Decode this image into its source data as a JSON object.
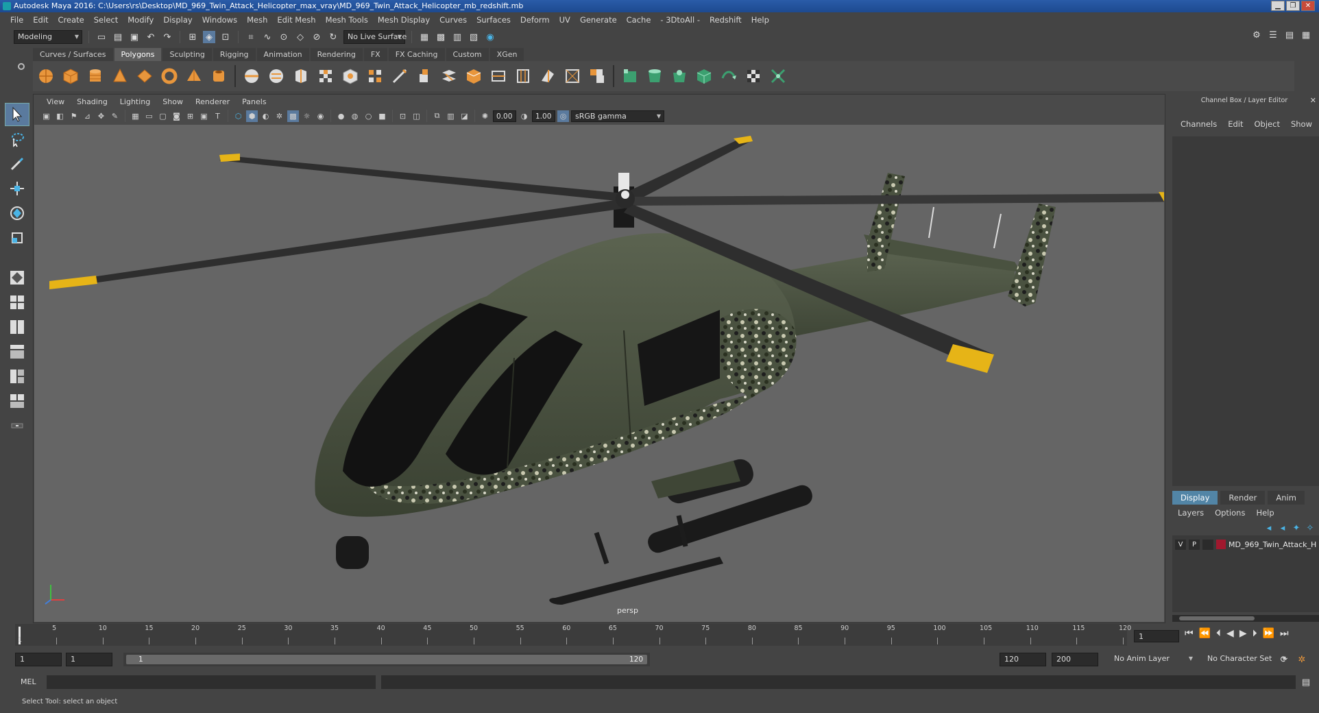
{
  "window": {
    "title": "Autodesk Maya 2016: C:\\Users\\rs\\Desktop\\MD_969_Twin_Attack_Helicopter_max_vray\\MD_969_Twin_Attack_Helicopter_mb_redshift.mb"
  },
  "menubar": {
    "items": [
      "File",
      "Edit",
      "Create",
      "Select",
      "Modify",
      "Display",
      "Windows",
      "Mesh",
      "Edit Mesh",
      "Mesh Tools",
      "Mesh Display",
      "Curves",
      "Surfaces",
      "Deform",
      "UV",
      "Generate",
      "Cache",
      "- 3DtoAll -",
      "Redshift",
      "Help"
    ]
  },
  "statusline": {
    "mode": "Modeling",
    "live_surface": "No Live Surface"
  },
  "shelf": {
    "tabs": [
      "Curves / Surfaces",
      "Polygons",
      "Sculpting",
      "Rigging",
      "Animation",
      "Rendering",
      "FX",
      "FX Caching",
      "Custom",
      "XGen"
    ],
    "active_tab": "Polygons"
  },
  "viewport": {
    "menu": [
      "View",
      "Shading",
      "Lighting",
      "Show",
      "Renderer",
      "Panels"
    ],
    "exposure": "0.00",
    "gamma": "1.00",
    "color_space": "sRGB gamma",
    "camera_label": "persp"
  },
  "channel_box": {
    "title": "Channel Box / Layer Editor",
    "menu": [
      "Channels",
      "Edit",
      "Object",
      "Show"
    ]
  },
  "layer_editor": {
    "tabs": [
      "Display",
      "Render",
      "Anim"
    ],
    "active_tab": "Display",
    "menu": [
      "Layers",
      "Options",
      "Help"
    ],
    "layer": {
      "visible": "V",
      "playback": "P",
      "name": "MD_969_Twin_Attack_H",
      "color": "#a0182e"
    }
  },
  "time_slider": {
    "ticks": [
      "5",
      "10",
      "15",
      "20",
      "25",
      "30",
      "35",
      "40",
      "45",
      "50",
      "55",
      "60",
      "65",
      "70",
      "75",
      "80",
      "85",
      "90",
      "95",
      "100",
      "105",
      "110",
      "115",
      "120"
    ],
    "start_tick": "1",
    "current_frame": "1"
  },
  "range_slider": {
    "start": "1",
    "playback_start": "1",
    "range_start_label": "1",
    "range_end_label": "120",
    "playback_end": "120",
    "end": "200",
    "anim_layer": "No Anim Layer",
    "character_set": "No Character Set"
  },
  "command_line": {
    "label": "MEL"
  },
  "help_line": {
    "text": "Select Tool: select an object"
  },
  "colors": {
    "helicopter_body": "#4a5240",
    "rotor_tip": "#e6b417",
    "viewport_bg": "#656565"
  }
}
